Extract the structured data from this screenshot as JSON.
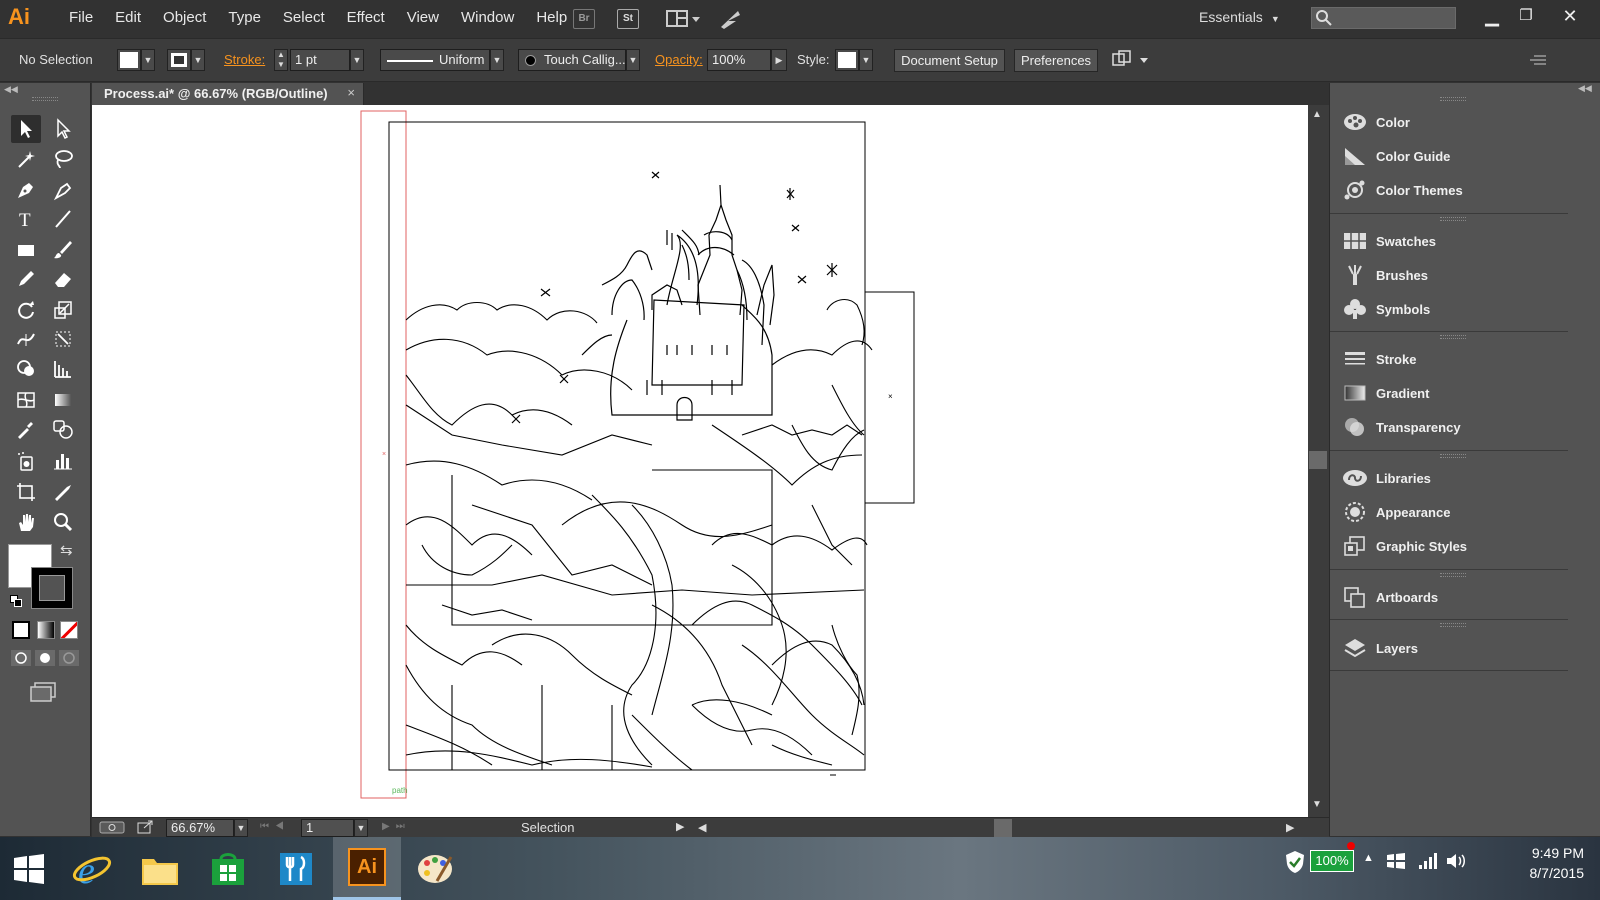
{
  "app": {
    "logo": "Ai"
  },
  "menu": [
    "File",
    "Edit",
    "Object",
    "Type",
    "Select",
    "Effect",
    "View",
    "Window",
    "Help"
  ],
  "menubar_icons": {
    "bridge": "Br",
    "stock": "St"
  },
  "workspace": {
    "label": "Essentials"
  },
  "control": {
    "selection": "No Selection",
    "stroke_label": "Stroke:",
    "stroke_value": "1 pt",
    "profile": "Uniform",
    "brush": "Touch Callig...",
    "opacity_label": "Opacity:",
    "opacity_value": "100%",
    "style_label": "Style:",
    "document_setup": "Document Setup",
    "preferences": "Preferences"
  },
  "document": {
    "tab_title": "Process.ai* @ 66.67% (RGB/Outline)",
    "close": "×"
  },
  "canvas": {
    "path_hint": "path"
  },
  "status": {
    "zoom": "66.67%",
    "artboard": "1",
    "tool": "Selection"
  },
  "panels": [
    {
      "label": "Color",
      "icon": "color-icon"
    },
    {
      "label": "Color Guide",
      "icon": "color-guide-icon"
    },
    {
      "label": "Color Themes",
      "icon": "color-themes-icon"
    },
    {
      "label": "Swatches",
      "icon": "swatches-icon"
    },
    {
      "label": "Brushes",
      "icon": "brushes-icon"
    },
    {
      "label": "Symbols",
      "icon": "symbols-icon"
    },
    {
      "label": "Stroke",
      "icon": "stroke-icon"
    },
    {
      "label": "Gradient",
      "icon": "gradient-icon"
    },
    {
      "label": "Transparency",
      "icon": "transparency-icon"
    },
    {
      "label": "Libraries",
      "icon": "libraries-icon"
    },
    {
      "label": "Appearance",
      "icon": "appearance-icon"
    },
    {
      "label": "Graphic Styles",
      "icon": "graphic-styles-icon"
    },
    {
      "label": "Artboards",
      "icon": "artboards-icon"
    },
    {
      "label": "Layers",
      "icon": "layers-icon"
    }
  ],
  "taskbar": {
    "battery": "100%",
    "time": "9:49 PM",
    "date": "8/7/2015",
    "illustrator": "Ai"
  },
  "colors": {
    "accent": "#f7931e",
    "panel": "#535353",
    "dark": "#323232",
    "artboard_guide": "#e06060"
  }
}
